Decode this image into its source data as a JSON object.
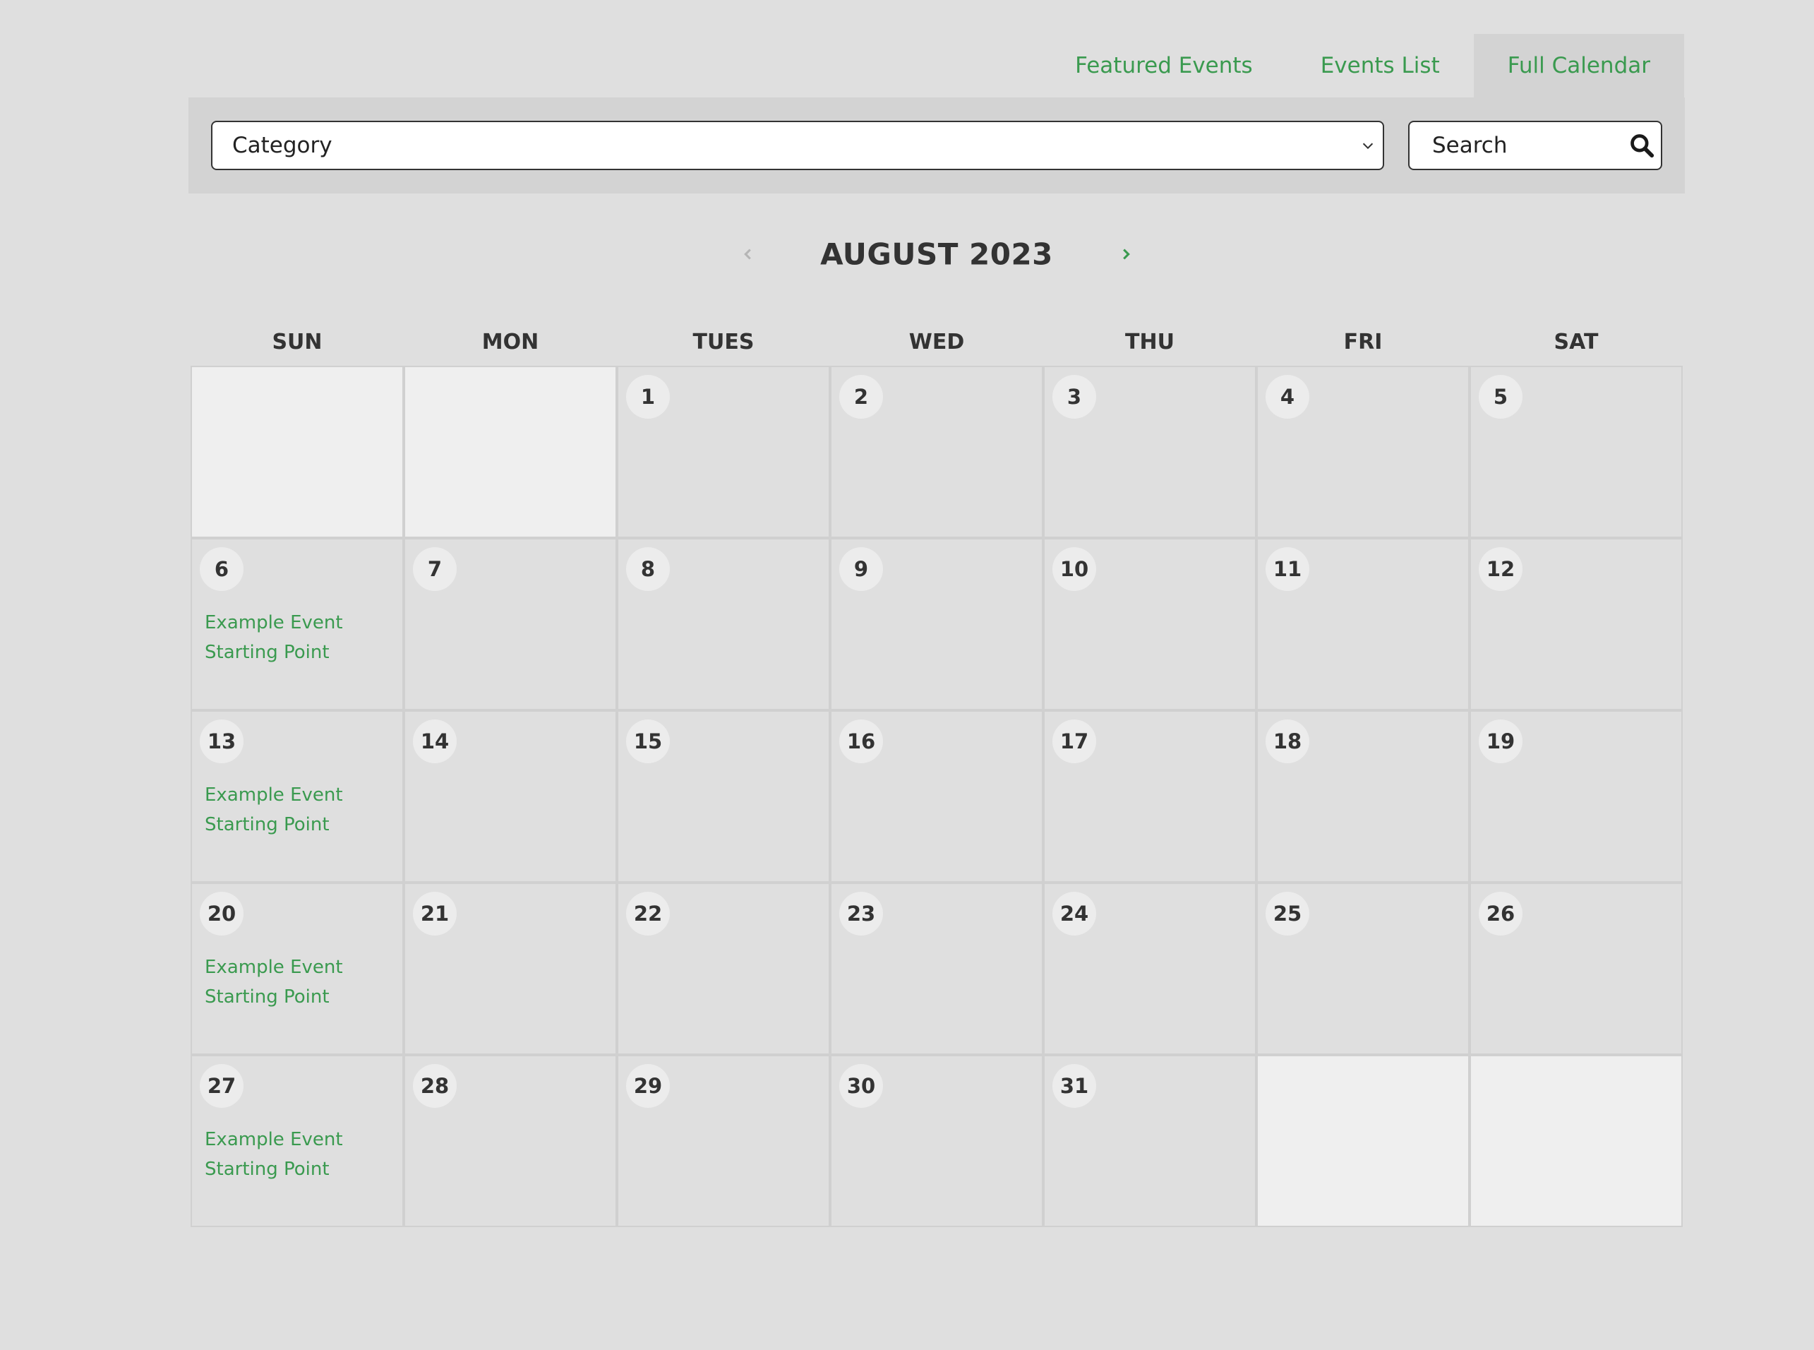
{
  "tabs": [
    {
      "label": "Featured Events",
      "active": false
    },
    {
      "label": "Events List",
      "active": false
    },
    {
      "label": "Full Calendar",
      "active": true
    }
  ],
  "filters": {
    "category": {
      "value": "Category",
      "icon": "chevron-down-icon"
    },
    "search": {
      "placeholder": "Search",
      "icon": "search-icon"
    }
  },
  "calendar": {
    "month_label": "AUGUST 2023",
    "prev_icon": "chevron-left-icon",
    "next_icon": "chevron-right-icon",
    "weekdays": [
      "SUN",
      "MON",
      "TUES",
      "WED",
      "THU",
      "FRI",
      "SAT"
    ],
    "cells": [
      {
        "day": "",
        "empty": true
      },
      {
        "day": "",
        "empty": true
      },
      {
        "day": "1"
      },
      {
        "day": "2"
      },
      {
        "day": "3"
      },
      {
        "day": "4"
      },
      {
        "day": "5"
      },
      {
        "day": "6",
        "event": "Example Event Starting Point"
      },
      {
        "day": "7"
      },
      {
        "day": "8"
      },
      {
        "day": "9"
      },
      {
        "day": "10"
      },
      {
        "day": "11"
      },
      {
        "day": "12"
      },
      {
        "day": "13",
        "event": "Example Event Starting Point"
      },
      {
        "day": "14"
      },
      {
        "day": "15"
      },
      {
        "day": "16"
      },
      {
        "day": "17"
      },
      {
        "day": "18"
      },
      {
        "day": "19"
      },
      {
        "day": "20",
        "event": "Example Event Starting Point"
      },
      {
        "day": "21"
      },
      {
        "day": "22"
      },
      {
        "day": "23"
      },
      {
        "day": "24"
      },
      {
        "day": "25"
      },
      {
        "day": "26"
      },
      {
        "day": "27",
        "event": "Example Event Starting Point"
      },
      {
        "day": "28"
      },
      {
        "day": "29"
      },
      {
        "day": "30"
      },
      {
        "day": "31"
      },
      {
        "day": "",
        "empty": true
      },
      {
        "day": "",
        "empty": true
      }
    ]
  },
  "colors": {
    "accent": "#3a9a4f",
    "page_background": "#dfdfdf",
    "bar_background": "#d3d3d3",
    "empty_cell": "#efefef",
    "text": "#333333"
  }
}
